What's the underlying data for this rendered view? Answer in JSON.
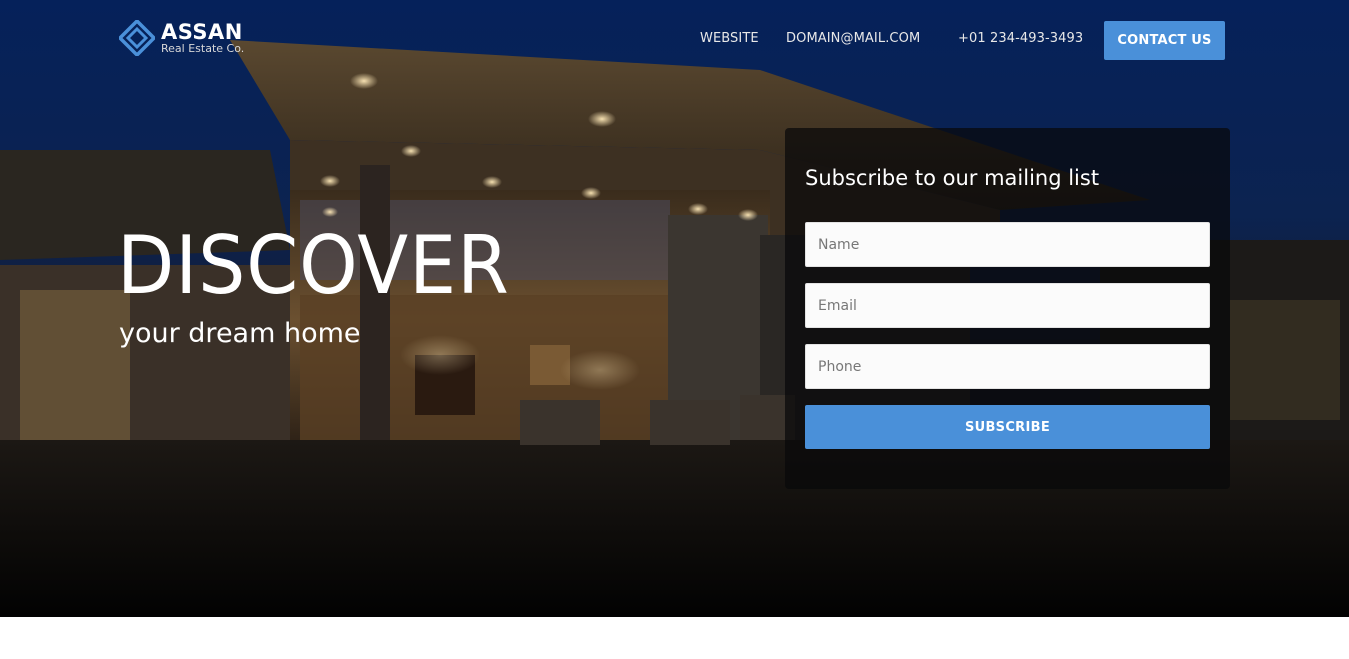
{
  "brand": {
    "name": "ASSAN",
    "tagline": "Real Estate Co.",
    "accent_color": "#4a90d9",
    "logo_icon": "diamond-logo-icon"
  },
  "nav": {
    "website": "WEBSITE",
    "email": "DOMAIN@MAIL.COM",
    "phone": "+01 234-493-3493",
    "contact_button": "CONTACT US"
  },
  "hero": {
    "headline": "DISCOVER",
    "subheadline": "your dream home",
    "background": "night-house-photo"
  },
  "form": {
    "title": "Subscribe to our mailing list",
    "name_placeholder": "Name",
    "email_placeholder": "Email",
    "phone_placeholder": "Phone",
    "submit_label": "SUBSCRIBE"
  }
}
